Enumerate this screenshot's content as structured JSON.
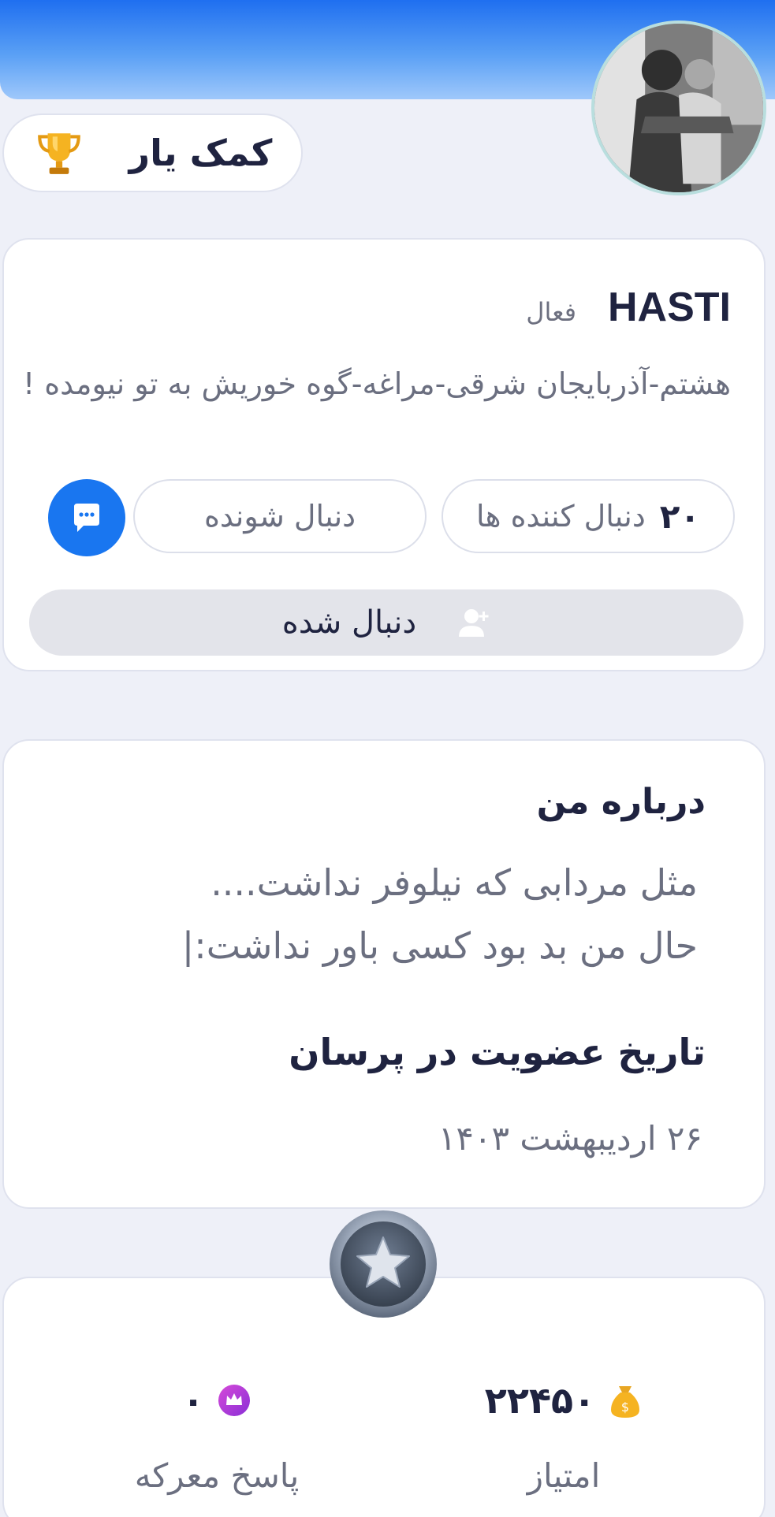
{
  "header": {
    "badge_label": "کمک یار",
    "badge_icon": "trophy-icon"
  },
  "profile": {
    "username": "HASTI",
    "status": "فعال",
    "bio": "هشتم-آذربایجان شرقی-مراغه-گوه خوریش به تو نیومده !",
    "followers_count": "۲۰",
    "followers_label": "دنبال کننده ها",
    "following_label": "دنبال شونده",
    "follow_button_label": "دنبال شده",
    "accent_color": "#1976f0"
  },
  "about": {
    "title": "درباره من",
    "text_line1": "مثل مردابی که نیلوفر نداشت....",
    "text_line2": "حال من بد بود کسی باور نداشت:|",
    "join_title": "تاریخ عضویت در پرسان",
    "join_date": "۲۶ اردیبهشت ۱۴۰۳"
  },
  "stats": {
    "points_value": "۲۲۴۵۰",
    "points_label": "امتیاز",
    "battle_value": "۰",
    "battle_label": "پاسخ معرکه"
  }
}
